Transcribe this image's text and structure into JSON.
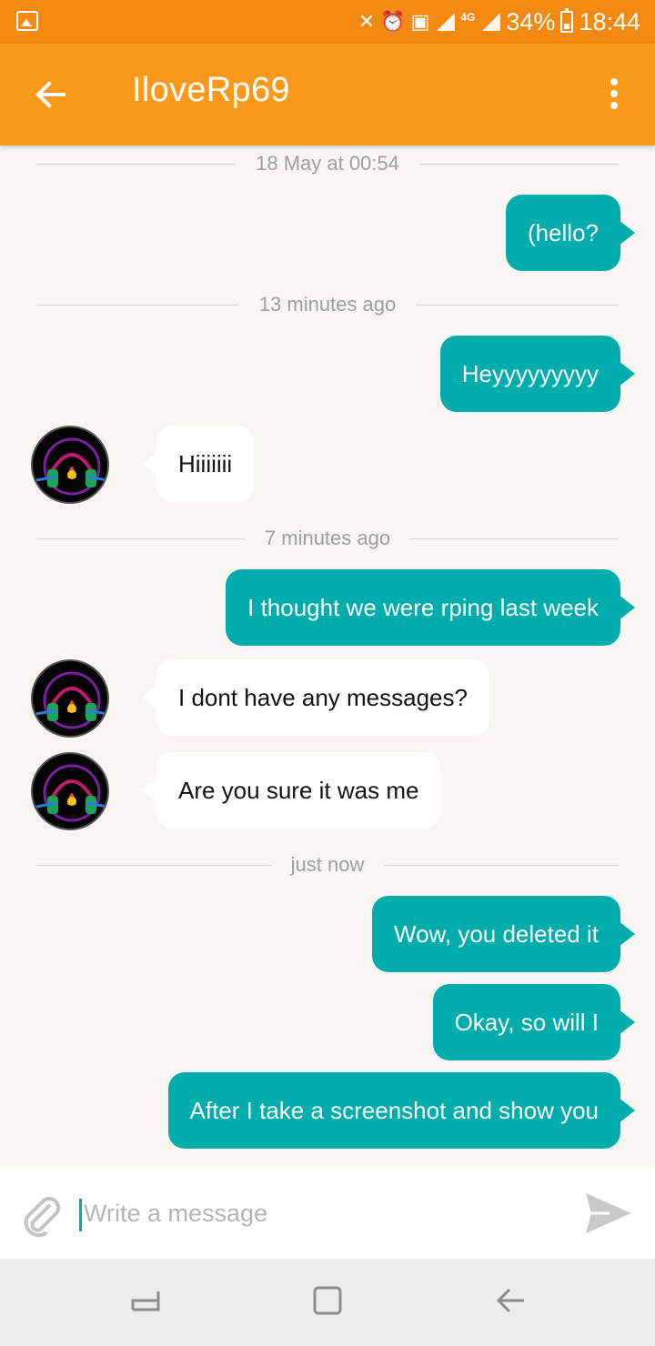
{
  "status_bar": {
    "battery": "34%",
    "time": "18:44",
    "network": "4G",
    "icons": [
      "gallery-icon",
      "mute-icon",
      "alarm-icon",
      "sim-icon",
      "signal-icon",
      "4g-signal-icon",
      "battery-icon"
    ]
  },
  "header": {
    "title": "IloveRp69",
    "back_icon": "arrow-left-icon",
    "menu_icon": "more-vert-icon"
  },
  "conversation": {
    "dividers": [
      "18 May at 00:54",
      "13 minutes ago",
      "7 minutes ago",
      "just now"
    ],
    "messages": [
      {
        "direction": "out",
        "text": "(hello?"
      },
      {
        "direction": "out",
        "text": "Heyyyyyyyyy"
      },
      {
        "direction": "in",
        "text": "Hiiiiiii"
      },
      {
        "direction": "out",
        "text": "I thought we were rping last week"
      },
      {
        "direction": "in",
        "text": "I dont have any messages?"
      },
      {
        "direction": "in",
        "text": "Are you sure it was me"
      },
      {
        "direction": "out",
        "text": "Wow, you deleted it"
      },
      {
        "direction": "out",
        "text": "Okay, so will I"
      },
      {
        "direction": "out",
        "text": "After I take a screenshot and show you"
      }
    ]
  },
  "composer": {
    "placeholder": "Write a message",
    "value": "",
    "attach_icon": "paperclip-icon",
    "send_icon": "send-icon"
  },
  "nav_bar": {
    "buttons": [
      "recents-icon",
      "home-icon",
      "back-icon"
    ]
  },
  "colors": {
    "status_bar": "#f58a12",
    "app_bar": "#fb991b",
    "outgoing_bubble": "#00acac",
    "incoming_bubble": "#ffffff",
    "background": "#f7f6f2"
  }
}
